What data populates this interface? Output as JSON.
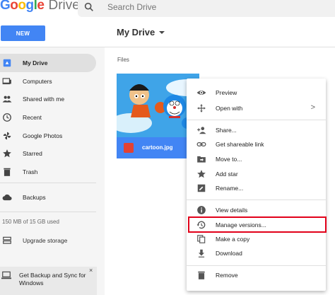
{
  "header": {
    "logo_letters": [
      "G",
      "o",
      "o",
      "g",
      "l",
      "e"
    ],
    "logo_colors": [
      "#4285f4",
      "#ea4335",
      "#fbbc05",
      "#4285f4",
      "#34a853",
      "#ea4335"
    ],
    "product": "Drive",
    "search_placeholder": "Search Drive"
  },
  "toolbar": {
    "new_label": "NEW",
    "breadcrumb": "My Drive",
    "accent": "#4285f4"
  },
  "sidebar": {
    "items": [
      {
        "label": "My Drive",
        "icon": "drive-icon",
        "active": true
      },
      {
        "label": "Computers",
        "icon": "computers-icon"
      },
      {
        "label": "Shared with me",
        "icon": "people-icon"
      },
      {
        "label": "Recent",
        "icon": "clock-icon"
      },
      {
        "label": "Google Photos",
        "icon": "pinwheel-icon"
      },
      {
        "label": "Starred",
        "icon": "star-icon"
      },
      {
        "label": "Trash",
        "icon": "trash-icon"
      },
      {
        "label": "Backups",
        "icon": "cloud-icon"
      }
    ],
    "storage": "150 MB of 15 GB used",
    "upgrade": "Upgrade storage",
    "banner_line1": "Get Backup and Sync for",
    "banner_line2": "Windows",
    "banner_close": "×"
  },
  "main": {
    "section_title": "Files",
    "file": {
      "name": "cartoon.jpg",
      "type": "image"
    }
  },
  "menu": {
    "items": [
      {
        "label": "Preview",
        "icon": "eye-icon"
      },
      {
        "label": "Open with",
        "icon": "move-arrows-icon",
        "chevron": ">"
      },
      {
        "label": "Share...",
        "icon": "person-add-icon"
      },
      {
        "label": "Get shareable link",
        "icon": "link-icon"
      },
      {
        "label": "Move to...",
        "icon": "folder-move-icon"
      },
      {
        "label": "Add star",
        "icon": "star-icon"
      },
      {
        "label": "Rename...",
        "icon": "pencil-icon"
      },
      {
        "label": "View details",
        "icon": "info-icon"
      },
      {
        "label": "Manage versions...",
        "icon": "history-icon",
        "highlighted": true
      },
      {
        "label": "Make a copy",
        "icon": "copy-icon"
      },
      {
        "label": "Download",
        "icon": "download-icon"
      },
      {
        "label": "Remove",
        "icon": "trash-icon"
      }
    ],
    "highlight_color": "#e2001a"
  }
}
